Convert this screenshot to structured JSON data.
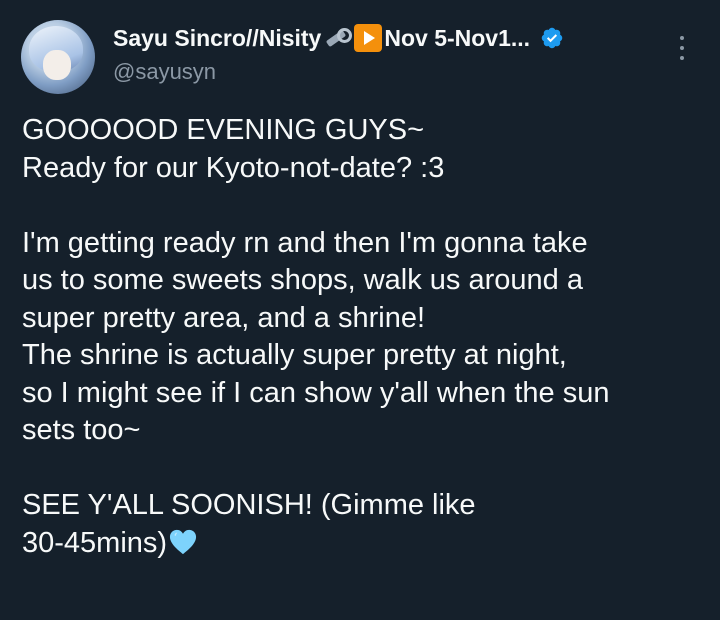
{
  "author": {
    "display_name_part1": "Sayu Sincro//Nisity",
    "display_name_part2": "Nov 5-Nov1...",
    "handle": "@sayusyn",
    "icons": [
      "nut-and-bolt-icon",
      "play-button-icon",
      "verified-badge-icon"
    ]
  },
  "tweet": {
    "lines": [
      "GOOOOOD EVENING GUYS~",
      "Ready for our Kyoto-not-date? :3",
      "",
      "I'm getting ready rn and then I'm gonna take",
      "us to some sweets shops, walk us around a",
      "super pretty area, and a shrine!",
      "The shrine is actually super pretty at night,",
      "so I might see if I can show y'all when the sun",
      "sets too~",
      "",
      "SEE Y'ALL SOONISH! (Gimme like",
      "30-45mins)"
    ],
    "trailing_emoji": "light-blue-heart-icon"
  },
  "colors": {
    "background": "#15202b",
    "text": "#f7f9f9",
    "secondary_text": "#8b98a5",
    "verified": "#1d9bf0",
    "heart": "#7dd3fc"
  }
}
